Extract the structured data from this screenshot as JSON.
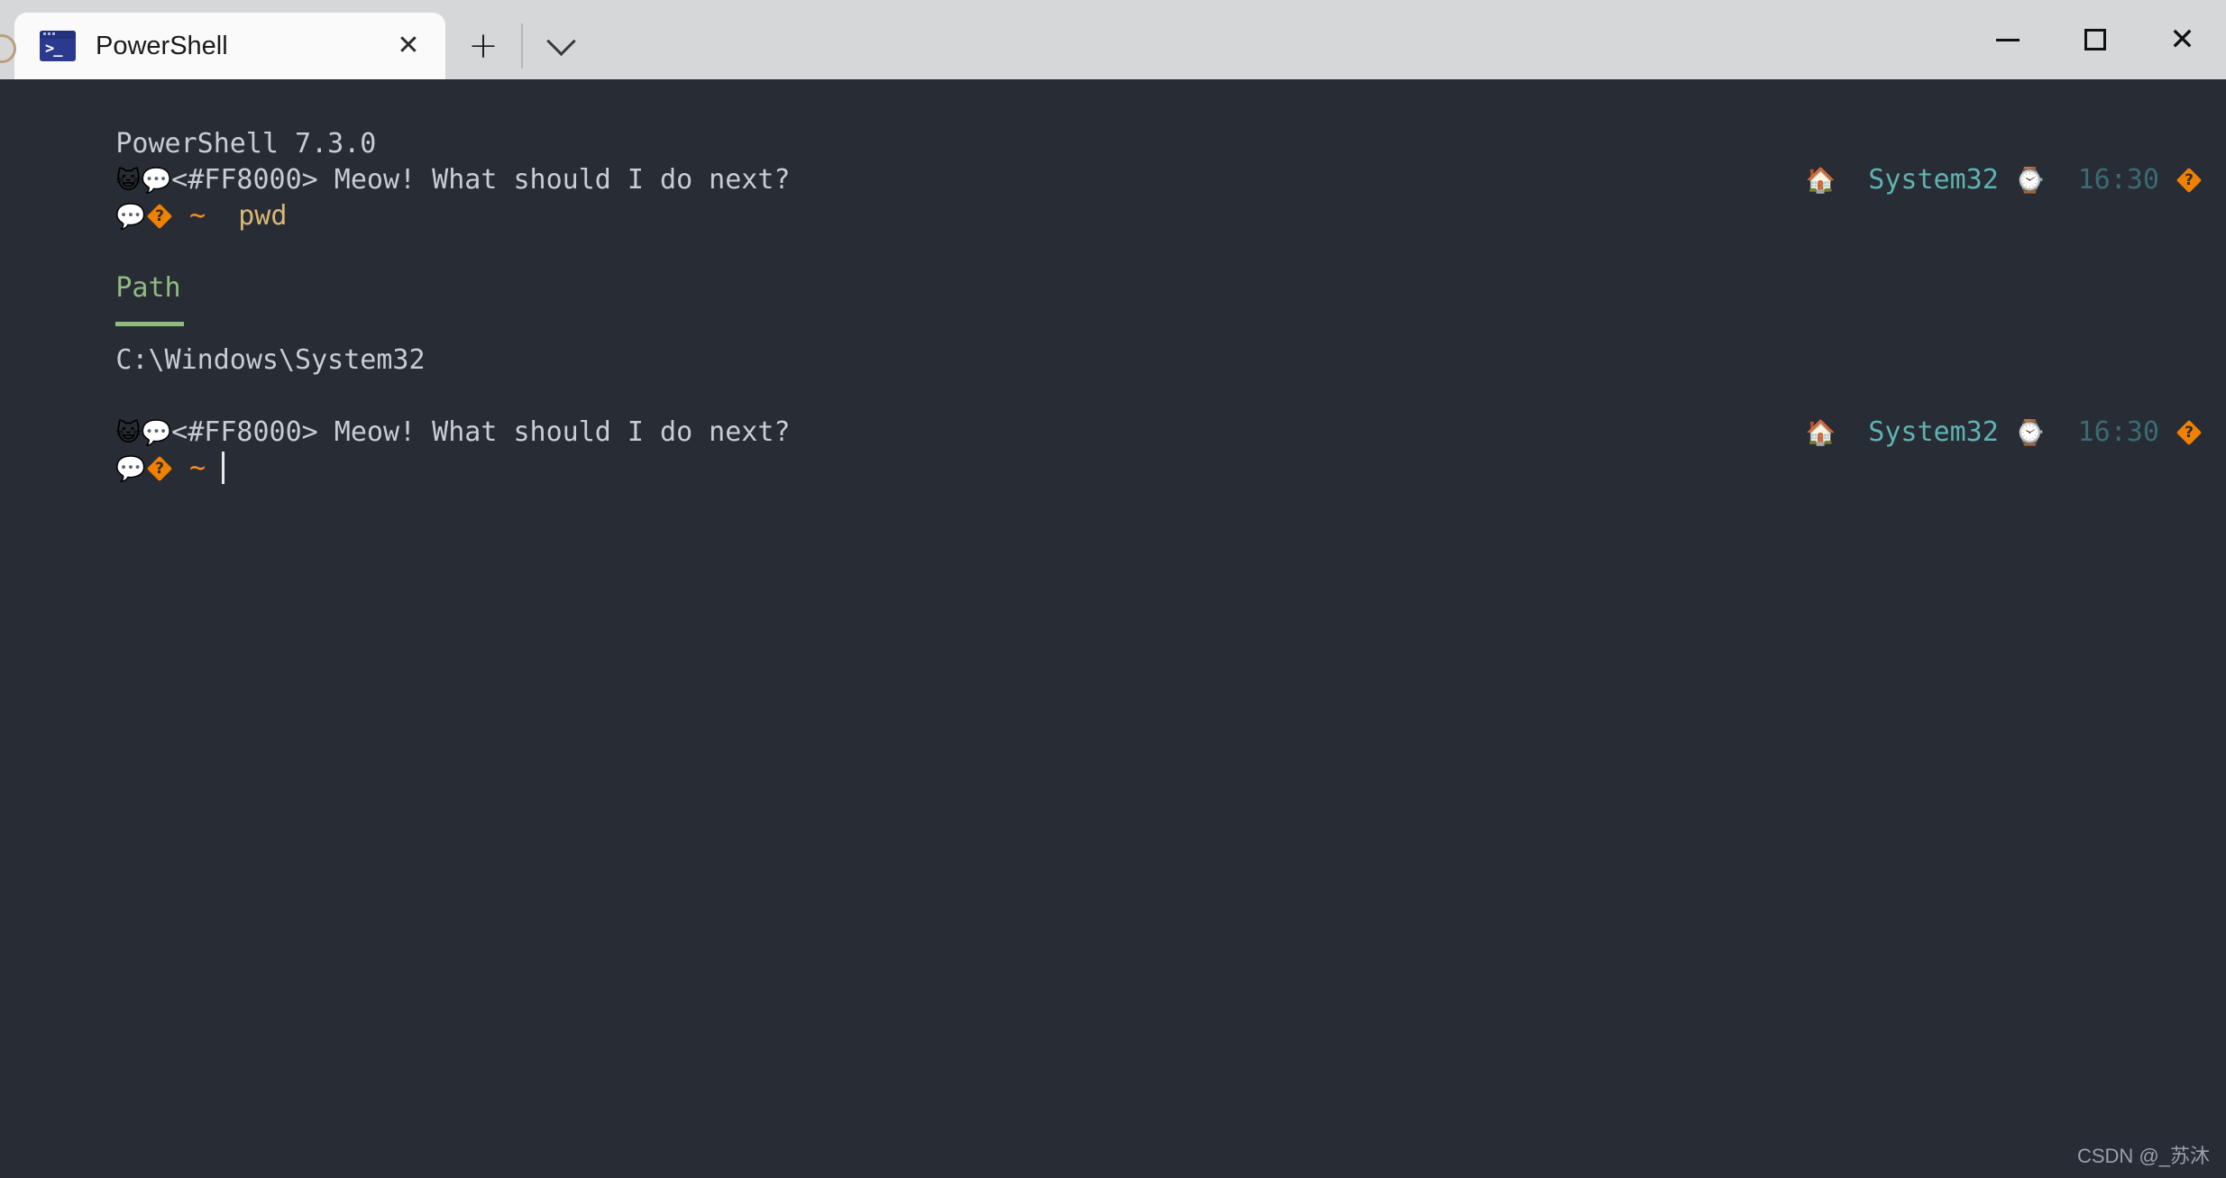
{
  "window": {
    "titlebar_color": "#d6d7d9",
    "controls": {
      "minimize_label": "—",
      "maximize_label": "□",
      "close_label": "✕"
    }
  },
  "tabs": {
    "items": [
      {
        "title": "PowerShell",
        "icon": "powershell-icon",
        "prompt_glyph": ">_",
        "close_label": "✕",
        "active": true
      }
    ],
    "new_tab_label": "+",
    "dropdown_label": "⌄"
  },
  "terminal": {
    "background": "#282c34",
    "foreground": "#c8ccd4",
    "accent_orange": "#ff8c1a",
    "accent_teal": "#5fb3b3",
    "accent_green": "#8fbc7f",
    "lines": {
      "banner": "PowerShell 7.3.0",
      "cat_emoji": "😺",
      "speech_emoji": "💬",
      "prompt_message": "<#FF8000> Meow! What should I do next?",
      "prompt_message_spaced": "<#FF8000> Meow! What should I do next?",
      "tilde": "~",
      "command": "pwd",
      "table_header": "Path",
      "table_value": "C:\\Windows\\System32"
    },
    "status": {
      "home_emoji": "🏠",
      "directory": "System32",
      "clock_emoji": "⌚",
      "time": "16:30",
      "trailing_glyph": "?"
    }
  },
  "watermark": "CSDN @_苏沐"
}
